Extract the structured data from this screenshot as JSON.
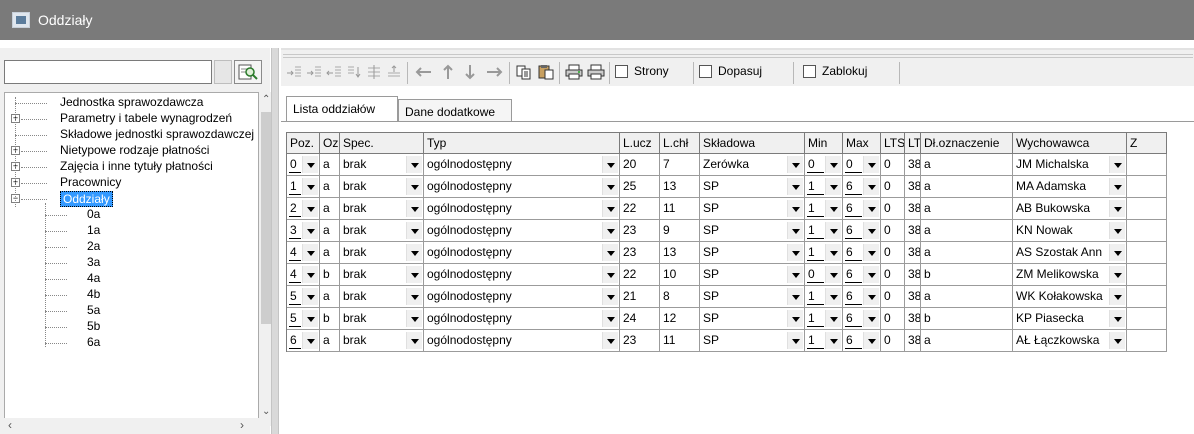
{
  "window": {
    "title": "Oddziały"
  },
  "search": {
    "value": "",
    "placeholder": ""
  },
  "tree": {
    "items": [
      {
        "label": "Jednostka sprawozdawcza",
        "expandable": false
      },
      {
        "label": "Parametry i tabele wynagrodzeń",
        "expandable": true
      },
      {
        "label": "Składowe jednostki sprawozdawczej",
        "expandable": false
      },
      {
        "label": "Nietypowe rodzaje płatności",
        "expandable": true
      },
      {
        "label": "Zajęcia i inne tytuły płatności",
        "expandable": true
      },
      {
        "label": "Pracownicy",
        "expandable": true
      },
      {
        "label": "Oddziały",
        "expandable": true,
        "expanded": true,
        "selected": true
      }
    ],
    "children": [
      "0a",
      "1a",
      "2a",
      "3a",
      "4a",
      "4b",
      "5a",
      "5b",
      "6a"
    ]
  },
  "toolbar": {
    "checkboxes": [
      {
        "label": "Strony",
        "checked": false
      },
      {
        "label": "Dopasuj",
        "checked": false
      },
      {
        "label": "Zablokuj",
        "checked": false
      }
    ]
  },
  "tabs": [
    {
      "label": "Lista oddziałów",
      "active": true
    },
    {
      "label": "Dane dodatkowe",
      "active": false
    }
  ],
  "grid": {
    "columns": [
      "Poz.",
      "Ozn",
      "Spec.",
      "Typ",
      "L.ucz",
      "L.chł",
      "Składowa",
      "Min",
      "Max",
      "LTS",
      "LT",
      "Dł.oznaczenie",
      "Wychowawca",
      "Z"
    ],
    "rows": [
      [
        "0",
        "a",
        "brak",
        "ogólnodostępny",
        "20",
        "7",
        "Zerówka",
        "0",
        "0",
        "0",
        "38",
        "a",
        "JM Michalska"
      ],
      [
        "1",
        "a",
        "brak",
        "ogólnodostępny",
        "25",
        "13",
        "SP",
        "1",
        "6",
        "0",
        "38",
        "a",
        "MA Adamska"
      ],
      [
        "2",
        "a",
        "brak",
        "ogólnodostępny",
        "22",
        "11",
        "SP",
        "1",
        "6",
        "0",
        "38",
        "a",
        "AB Bukowska"
      ],
      [
        "3",
        "a",
        "brak",
        "ogólnodostępny",
        "23",
        "9",
        "SP",
        "1",
        "6",
        "0",
        "38",
        "a",
        "KN Nowak"
      ],
      [
        "4",
        "a",
        "brak",
        "ogólnodostępny",
        "23",
        "13",
        "SP",
        "1",
        "6",
        "0",
        "38",
        "a",
        "AS Szostak Ann"
      ],
      [
        "4",
        "b",
        "brak",
        "ogólnodostępny",
        "22",
        "10",
        "SP",
        "0",
        "6",
        "0",
        "38",
        "b",
        "ZM Melikowska"
      ],
      [
        "5",
        "a",
        "brak",
        "ogólnodostępny",
        "21",
        "8",
        "SP",
        "1",
        "6",
        "0",
        "38",
        "a",
        "WK Kołakowska"
      ],
      [
        "5",
        "b",
        "brak",
        "ogólnodostępny",
        "24",
        "12",
        "SP",
        "1",
        "6",
        "0",
        "38",
        "b",
        "KP Piasecka"
      ],
      [
        "6",
        "a",
        "brak",
        "ogólnodostępny",
        "23",
        "11",
        "SP",
        "1",
        "6",
        "0",
        "38",
        "a",
        "AŁ Łączkowska"
      ]
    ]
  }
}
